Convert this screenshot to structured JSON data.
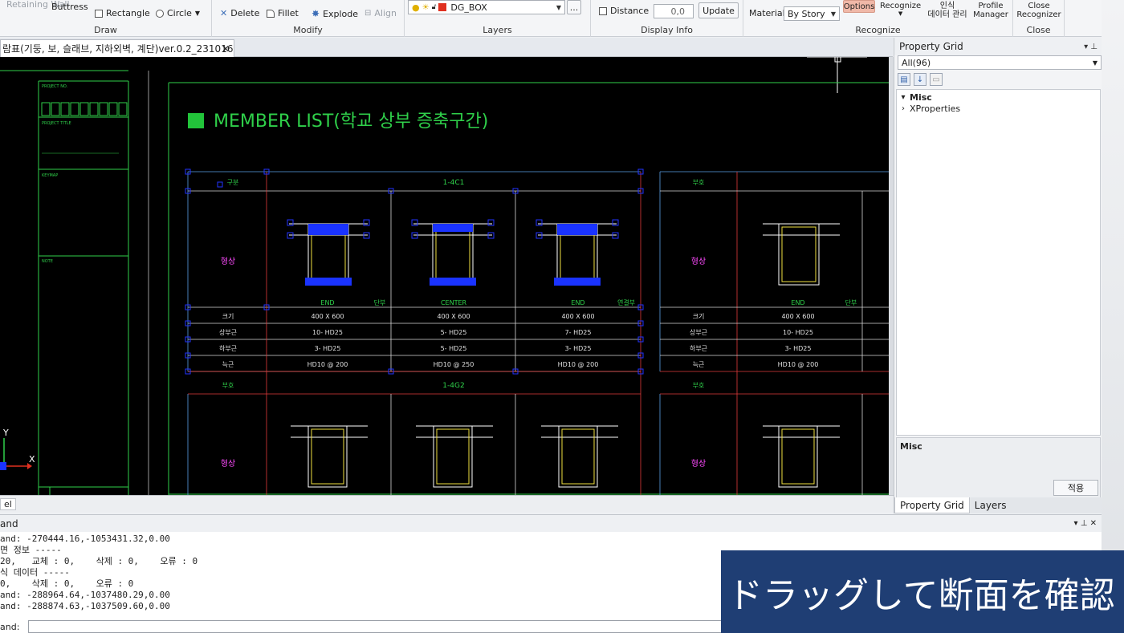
{
  "ribbon": {
    "draw_top_items": [
      "Retaining Wall",
      "Buttress"
    ],
    "draw": {
      "rectangle": "Rectangle",
      "circle": "Circle",
      "label": "Draw"
    },
    "modify": {
      "delete": "Delete",
      "fillet": "Fillet",
      "explode": "Explode",
      "align": "Align",
      "label": "Modify"
    },
    "layers": {
      "value": "DG_BOX",
      "more": "...",
      "label": "Layers"
    },
    "display": {
      "distance_label": "Distance",
      "distance_value": "0,0",
      "update": "Update",
      "label": "Display Info"
    },
    "recognize": {
      "material_label": "Material",
      "material_value": "By Story",
      "options": "Options",
      "recognize": "Recognize",
      "data_manage": "인식\n데이터 관리",
      "profile_manager": "Profile\nManager",
      "label": "Recognize"
    },
    "close": {
      "close_recognizer": "Close\nRecognizer",
      "label": "Close"
    }
  },
  "doc_tab": {
    "title": "람표(기둥, 보, 슬래브, 지하외벽, 계단)ver.0.2_231016",
    "close": "✕"
  },
  "drawing": {
    "title": "MEMBER LIST(학교 상부 증축구간)",
    "project_no": "PROJECT NO.",
    "project_title": "PROJECT TITLE",
    "key_map": "KEYMAP",
    "note": "NOTE",
    "member1": "1-4C1",
    "member2": "1-4G2",
    "col_labels": [
      "END",
      "CENTER",
      "END"
    ],
    "col_extra": [
      "단부",
      "연결부"
    ],
    "right_col_label": "END",
    "right_extra": "단부",
    "row_head_top": "구분",
    "row_head_left": "형상",
    "right_head": "부호",
    "rows": [
      {
        "label": "크기",
        "cells": [
          "400 X 600",
          "400 X 600",
          "400 X 600"
        ],
        "right": "400 X 600"
      },
      {
        "label": "상부근",
        "cells": [
          "10- HD25",
          "5- HD25",
          "7- HD25"
        ],
        "right": "10- HD25"
      },
      {
        "label": "하부근",
        "cells": [
          "3- HD25",
          "5- HD25",
          "3- HD25"
        ],
        "right": "3- HD25"
      },
      {
        "label": "늑근",
        "cells": [
          "HD10 @ 200",
          "HD10 @ 250",
          "HD10 @ 200"
        ],
        "right": "HD10 @ 200"
      }
    ],
    "axis_y": "Y",
    "axis_x": "X"
  },
  "model_tab": "el",
  "panel": {
    "title": "Property Grid",
    "filter": "All(96)",
    "category": "Misc",
    "item": "XProperties",
    "desc_title": "Misc",
    "apply": "적용",
    "tabs": [
      "Property Grid",
      "Layers"
    ]
  },
  "command": {
    "title": "and",
    "lines": [
      "and: -270444.16,-1053431.32,0.00",
      "면 정보 -----",
      "20,   교체 : 0,    삭제 : 0,    오류 : 0",
      "식 데이터 -----",
      "0,    삭제 : 0,    오류 : 0",
      "and: -288964.64,-1037480.29,0.00",
      "and: -288874.63,-1037509.60,0.00"
    ],
    "prompt": "and:"
  },
  "subtitle": "ドラッグして断面を確認"
}
